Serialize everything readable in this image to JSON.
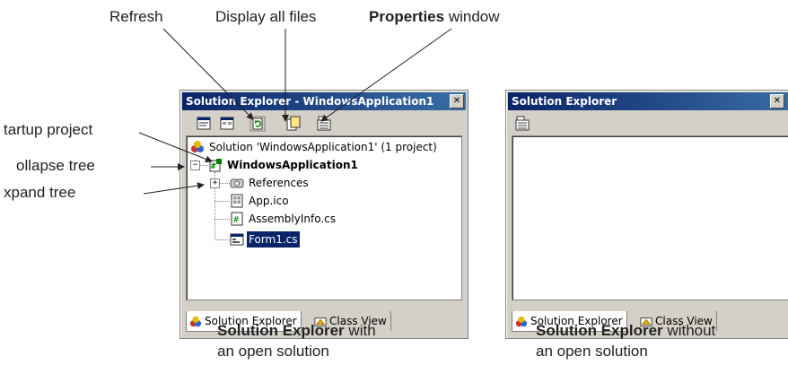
{
  "callouts": {
    "refresh": "Refresh",
    "display_all_files": "Display all files",
    "properties_bold": "Properties",
    "properties_rest": " window",
    "startup_project": "tartup project",
    "collapse_tree": "ollapse tree",
    "expand_tree": "xpand tree"
  },
  "left_window": {
    "title": "Solution Explorer - WindowsApplication1",
    "close": "✕",
    "tree": {
      "solution": "Solution 'WindowsApplication1' (1 project)",
      "project": "WindowsApplication1",
      "expander_collapse": "−",
      "expander_expand": "+",
      "items": [
        "References",
        "App.ico",
        "AssemblyInfo.cs",
        "Form1.cs"
      ]
    },
    "tabs": [
      "Solution Explorer",
      "Class View"
    ]
  },
  "right_window": {
    "title": "Solution Explorer",
    "close": "✕",
    "tabs": [
      "Solution Explorer",
      "Class View"
    ]
  },
  "captions": {
    "left_bold": "Solution Explorer",
    "left_rest": " with",
    "left_line2": "an open solution",
    "right_bold": "Solution Explorer",
    "right_rest": " without",
    "right_line2": "an open solution"
  },
  "colors": {
    "titlebar_start": "#0a246a",
    "titlebar_end": "#3a6ea5",
    "window_face": "#d4d0c8",
    "selection": "#0a246a"
  },
  "icons": [
    "view-code-icon",
    "view-designer-icon",
    "refresh-icon",
    "show-all-files-icon",
    "properties-icon",
    "solution-icon",
    "project-icon",
    "references-icon",
    "ico-file-icon",
    "cs-file-icon",
    "form-icon",
    "solution-explorer-tab-icon",
    "class-view-tab-icon"
  ]
}
